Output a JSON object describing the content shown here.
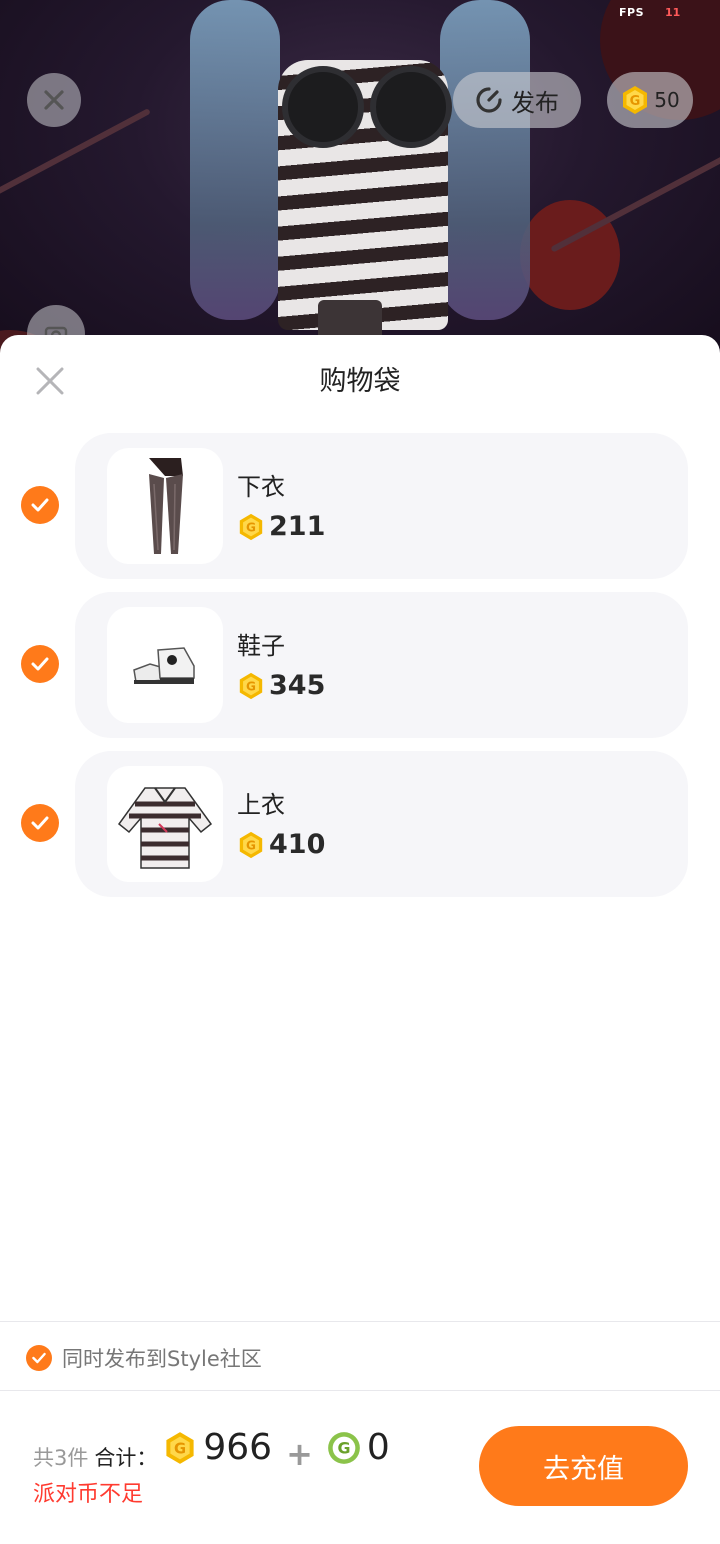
{
  "status": {
    "fps_label": "FPS",
    "fps_value": "11"
  },
  "scene": {
    "publish_label": "发布",
    "coin_balance": "50"
  },
  "sheet": {
    "title": "购物袋",
    "items": [
      {
        "name": "下衣",
        "price": "211",
        "thumbnail_icon": "leggings-icon",
        "checked": true
      },
      {
        "name": "鞋子",
        "price": "345",
        "thumbnail_icon": "shoes-icon",
        "checked": true
      },
      {
        "name": "上衣",
        "price": "410",
        "thumbnail_icon": "sweater-icon",
        "checked": true
      }
    ],
    "publish_option": {
      "label": "同时发布到Style社区",
      "checked": true
    }
  },
  "footer": {
    "count_text": "共3件",
    "sum_label": "合计：",
    "gold_total": "966",
    "plus": "+",
    "green_total": "0",
    "warning": "派对币不足",
    "recharge_label": "去充值"
  },
  "colors": {
    "accent": "#ff7a1a",
    "warning": "#ff3b30",
    "card_bg": "#f6f6f9",
    "gold_coin": "#f5b800",
    "green_coin": "#8bc34a"
  }
}
